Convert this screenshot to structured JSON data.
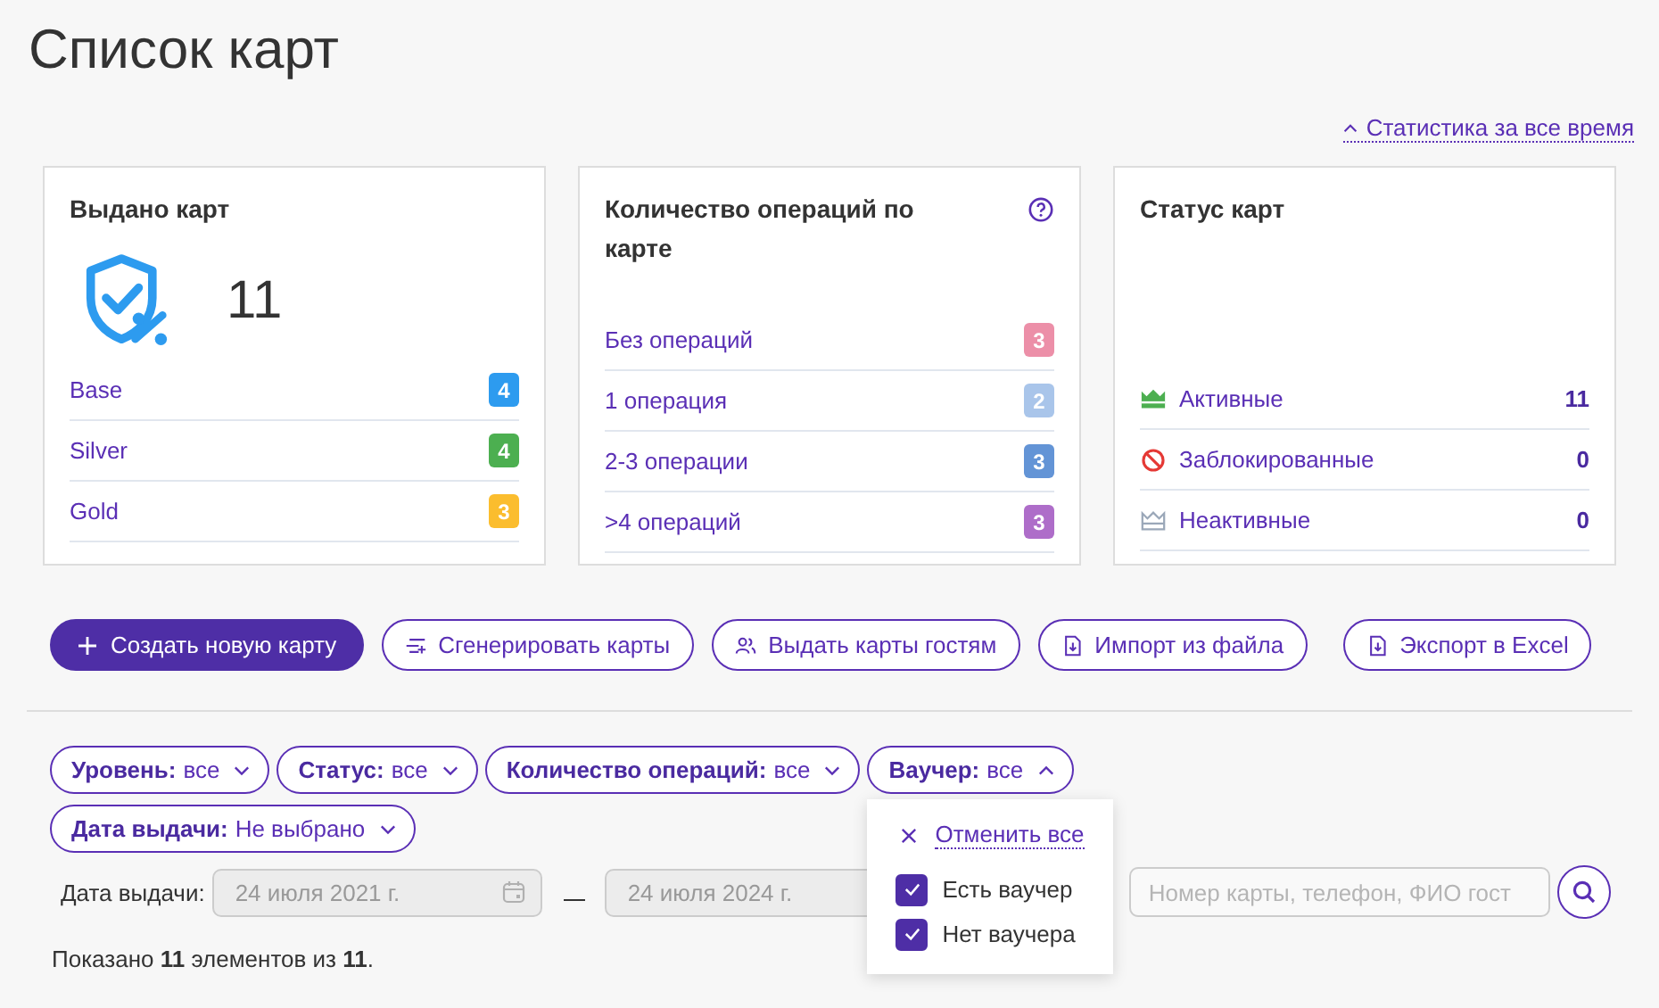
{
  "title": "Список карт",
  "stats_toggle": {
    "label": "Статистика за все время",
    "expanded": true
  },
  "cards": [
    {
      "kind": "issued",
      "title": "Выдано карт",
      "total": "11",
      "rows": [
        {
          "label": "Base",
          "count": "4",
          "color": "#2d9bef"
        },
        {
          "label": "Silver",
          "count": "4",
          "color": "#4caf50"
        },
        {
          "label": "Gold",
          "count": "3",
          "color": "#fbbd2e"
        }
      ]
    },
    {
      "kind": "operations",
      "title": "Количество операций по карте",
      "help": true,
      "rows": [
        {
          "label": "Без операций",
          "count": "3",
          "color": "#ec8fa8"
        },
        {
          "label": "1 операция",
          "count": "2",
          "color": "#a9c5ea"
        },
        {
          "label": "2-3 операции",
          "count": "3",
          "color": "#6394d6"
        },
        {
          "label": ">4 операций",
          "count": "3",
          "color": "#ae6dc9"
        }
      ]
    },
    {
      "kind": "status",
      "title": "Статус карт",
      "rows": [
        {
          "kind": "active",
          "label": "Активные",
          "count": "11"
        },
        {
          "kind": "blocked",
          "label": "Заблокированные",
          "count": "0"
        },
        {
          "kind": "inactive",
          "label": "Неактивные",
          "count": "0"
        }
      ]
    }
  ],
  "actions": [
    {
      "kind": "plus",
      "label": "Создать новую карту",
      "primary": true
    },
    {
      "kind": "list",
      "label": "Сгенерировать карты",
      "primary": false
    },
    {
      "kind": "users",
      "label": "Выдать карты гостям",
      "primary": false
    },
    {
      "kind": "file",
      "label": "Импорт из файла",
      "primary": false
    },
    {
      "kind": "file",
      "label": "Экспорт в Excel",
      "primary": false
    }
  ],
  "filters": [
    {
      "label": "Уровень:",
      "value": "все",
      "open": false
    },
    {
      "label": "Статус:",
      "value": "все",
      "open": false
    },
    {
      "label": "Количество операций:",
      "value": "все",
      "open": false
    },
    {
      "label": "Ваучер:",
      "value": "все",
      "open": true,
      "menu": {
        "clear": "Отменить все",
        "options": [
          {
            "label": "Есть ваучер",
            "checked": true
          },
          {
            "label": "Нет ваучера",
            "checked": true
          }
        ]
      }
    },
    {
      "label": "Дата выдачи:",
      "value": "Не выбрано",
      "open": false
    }
  ],
  "date_filter": {
    "label": "Дата выдачи:",
    "from": {
      "value": "24 июля 2021 г."
    },
    "to": {
      "value": "24 июля 2024 г."
    }
  },
  "search": {
    "placeholder": "Номер карты, телефон, ФИО гост"
  },
  "summary": "Показано **11** элементов из **11**."
}
